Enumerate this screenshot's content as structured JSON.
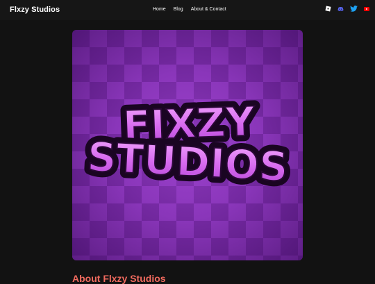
{
  "header": {
    "brand": "Flxzy Studios",
    "nav": [
      "Home",
      "Blog",
      "About & Contact"
    ]
  },
  "social": {
    "icons": [
      "roblox-icon",
      "discord-icon",
      "twitter-icon",
      "youtube-icon"
    ],
    "colors": {
      "roblox": "#ffffff",
      "discord": "#5865f2",
      "twitter": "#1da1f2",
      "youtube": "#ff0000"
    }
  },
  "hero": {
    "logo_line1": "FIXZY",
    "logo_line2": "STUDIOS",
    "colors": {
      "background": "#7b2fa8",
      "logo_fill": "#e07cf4",
      "logo_outline": "#1a0522"
    }
  },
  "about": {
    "heading": "About Flxzy Studios",
    "color": "#f06a5e"
  }
}
